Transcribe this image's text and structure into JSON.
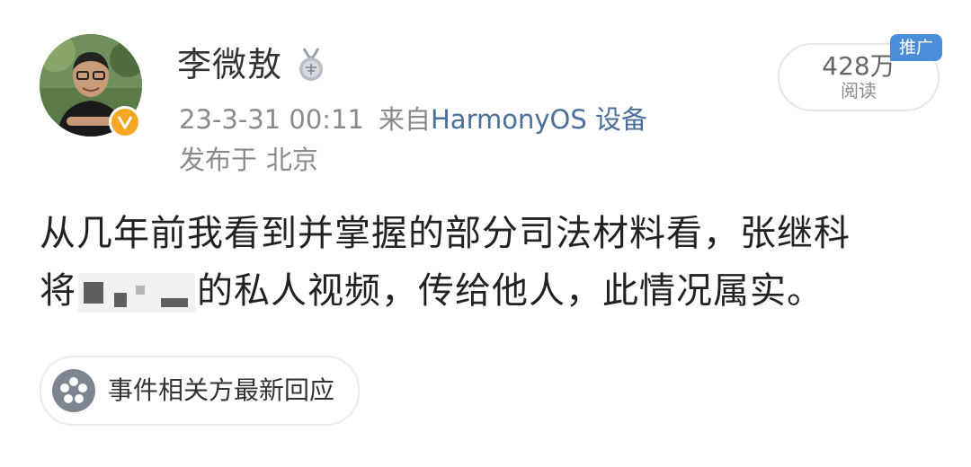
{
  "author": {
    "name": "李微敖",
    "medal_icon": "medal-icon",
    "verified_icon": "verified-v-icon",
    "verified_color": "#f5a623"
  },
  "meta": {
    "timestamp": "23-3-31 00:11",
    "source_prefix": "来自",
    "device": "HarmonyOS 设备",
    "location_prefix": "发布于",
    "location": "北京"
  },
  "stats": {
    "reads_count": "428万",
    "reads_label": "阅读",
    "promo_badge": "推广",
    "promo_color": "#4a8ed9"
  },
  "post": {
    "line1": "从几年前我看到并掌握的部分司法材料看，张继科",
    "line2_prefix": "将",
    "line2_suffix": "的私人视频，传给他人，此情况属实。"
  },
  "event_chip": {
    "label": "事件相关方最新回应",
    "icon": "flower-icon"
  },
  "colors": {
    "link": "#4a6f9b",
    "meta_text": "#8a8a8a",
    "body_text": "#222222"
  }
}
